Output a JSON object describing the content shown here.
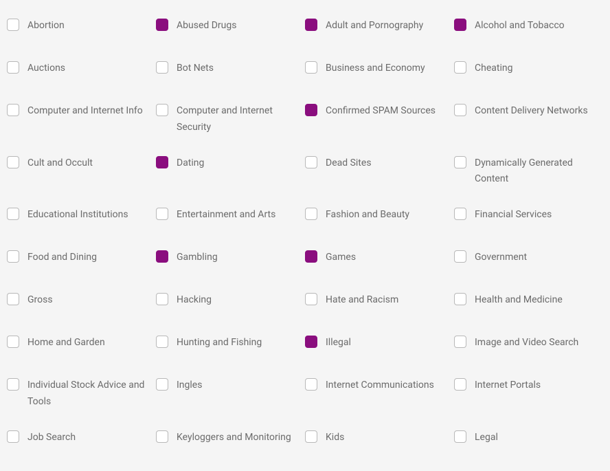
{
  "categories": [
    {
      "label": "Abortion",
      "checked": false
    },
    {
      "label": "Abused Drugs",
      "checked": true
    },
    {
      "label": "Adult and Pornography",
      "checked": true
    },
    {
      "label": "Alcohol and Tobacco",
      "checked": true
    },
    {
      "label": "Auctions",
      "checked": false
    },
    {
      "label": "Bot Nets",
      "checked": false
    },
    {
      "label": "Business and Economy",
      "checked": false
    },
    {
      "label": "Cheating",
      "checked": false
    },
    {
      "label": "Computer and Internet Info",
      "checked": false
    },
    {
      "label": "Computer and Internet Security",
      "checked": false
    },
    {
      "label": "Confirmed SPAM Sources",
      "checked": true
    },
    {
      "label": "Content Delivery Networks",
      "checked": false
    },
    {
      "label": "Cult and Occult",
      "checked": false
    },
    {
      "label": "Dating",
      "checked": true
    },
    {
      "label": "Dead Sites",
      "checked": false
    },
    {
      "label": "Dynamically Generated Content",
      "checked": false
    },
    {
      "label": "Educational Institutions",
      "checked": false
    },
    {
      "label": "Entertainment and Arts",
      "checked": false
    },
    {
      "label": "Fashion and Beauty",
      "checked": false
    },
    {
      "label": "Financial Services",
      "checked": false
    },
    {
      "label": "Food and Dining",
      "checked": false
    },
    {
      "label": "Gambling",
      "checked": true
    },
    {
      "label": "Games",
      "checked": true
    },
    {
      "label": "Government",
      "checked": false
    },
    {
      "label": "Gross",
      "checked": false
    },
    {
      "label": "Hacking",
      "checked": false
    },
    {
      "label": "Hate and Racism",
      "checked": false
    },
    {
      "label": "Health and Medicine",
      "checked": false
    },
    {
      "label": "Home and Garden",
      "checked": false
    },
    {
      "label": "Hunting and Fishing",
      "checked": false
    },
    {
      "label": "Illegal",
      "checked": true
    },
    {
      "label": "Image and Video Search",
      "checked": false
    },
    {
      "label": "Individual Stock Advice and Tools",
      "checked": false
    },
    {
      "label": "Ingles",
      "checked": false
    },
    {
      "label": "Internet Communications",
      "checked": false
    },
    {
      "label": "Internet Portals",
      "checked": false
    },
    {
      "label": "Job Search",
      "checked": false
    },
    {
      "label": "Keyloggers and Monitoring",
      "checked": false
    },
    {
      "label": "Kids",
      "checked": false
    },
    {
      "label": "Legal",
      "checked": false
    }
  ]
}
